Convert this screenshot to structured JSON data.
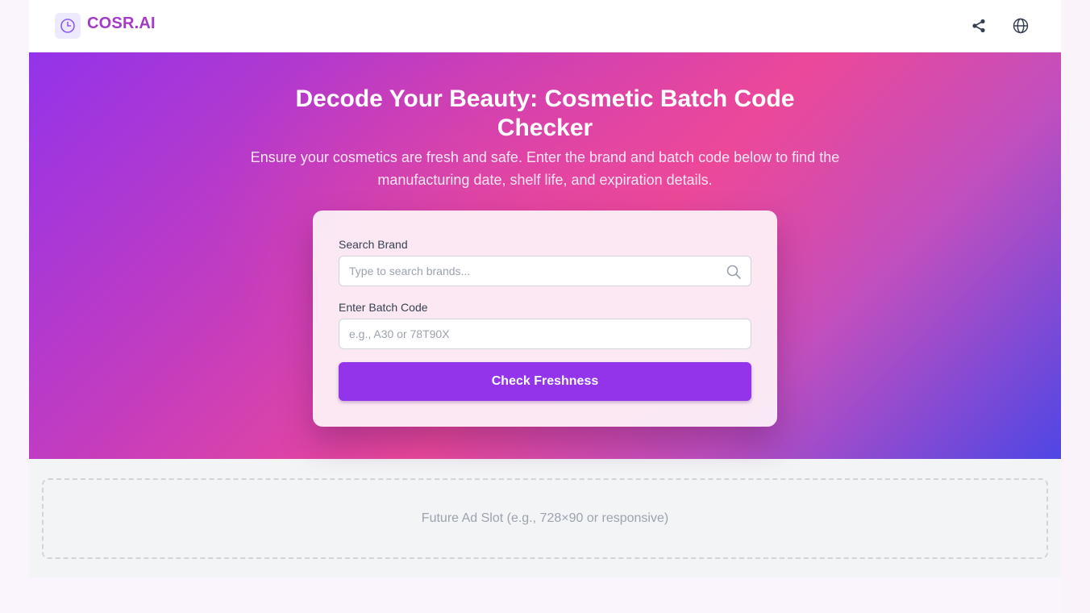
{
  "header": {
    "brand_name": "COSR.AI",
    "share_icon": "share-icon",
    "language_icon": "globe-icon"
  },
  "hero": {
    "title": "Decode Your Beauty: Cosmetic Batch Code Checker",
    "subtitle": "Ensure your cosmetics are fresh and safe. Enter the brand and batch code below to find the manufacturing date, shelf life, and expiration details."
  },
  "form": {
    "brand_label": "Search Brand",
    "brand_value": "",
    "brand_placeholder": "Type to search brands...",
    "batch_label": "Enter Batch Code",
    "batch_value": "",
    "batch_placeholder": "e.g., A30 or 78T90X",
    "submit_label": "Check Freshness"
  },
  "ad": {
    "text": "Future Ad Slot (e.g., 728×90 or responsive)"
  },
  "colors": {
    "brand": "#a23bc7",
    "primary_button": "#9333ea",
    "hero_gradient": [
      "#9333ea",
      "#ec4899",
      "#4f46e5"
    ]
  }
}
